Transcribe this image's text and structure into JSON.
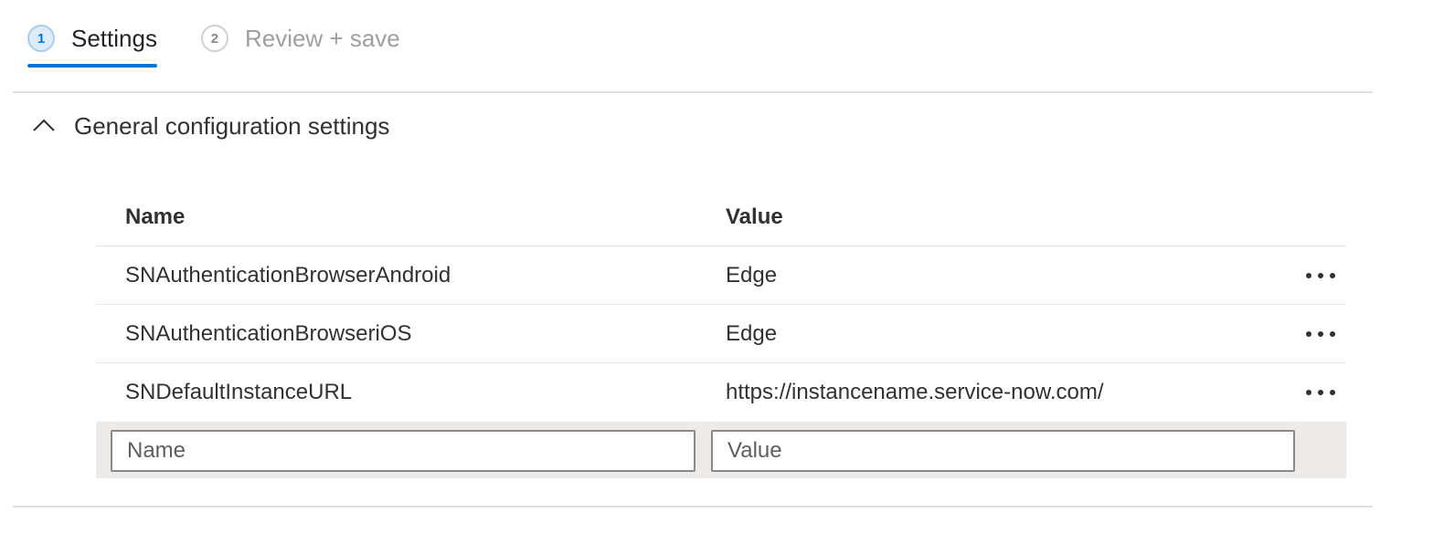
{
  "wizard": {
    "steps": [
      {
        "number": "1",
        "label": "Settings",
        "state": "active"
      },
      {
        "number": "2",
        "label": "Review + save",
        "state": "inactive"
      }
    ]
  },
  "section": {
    "title": "General configuration settings",
    "icon": "chevron-up-icon",
    "expanded": true
  },
  "table": {
    "headers": {
      "name": "Name",
      "value": "Value"
    },
    "rows": [
      {
        "name": "SNAuthenticationBrowserAndroid",
        "value": "Edge"
      },
      {
        "name": "SNAuthenticationBrowseriOS",
        "value": "Edge"
      },
      {
        "name": "SNDefaultInstanceURL",
        "value": "https://instancename.service-now.com/"
      }
    ],
    "row_action_icon": "more-horizontal-icon",
    "new_row": {
      "name_placeholder": "Name",
      "name_value": "",
      "value_placeholder": "Value",
      "value_value": ""
    }
  },
  "colors": {
    "accent": "#0078d4",
    "divider": "#e1dfdd",
    "new_row_background": "#edebe9"
  }
}
